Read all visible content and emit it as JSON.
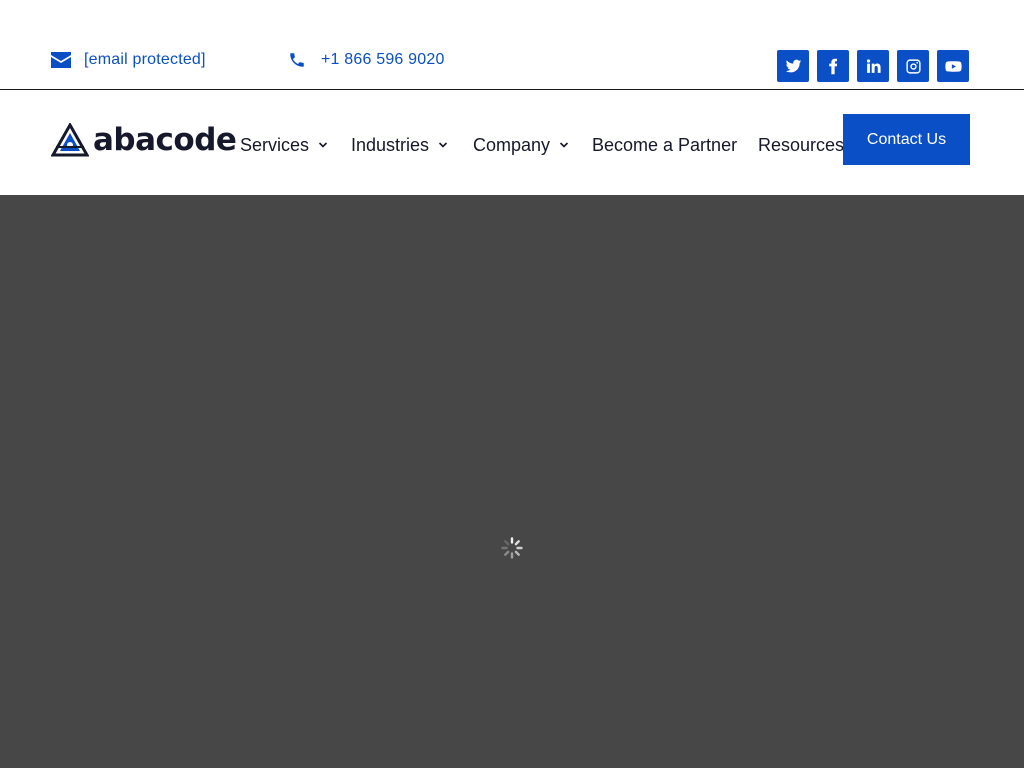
{
  "topbar": {
    "email": {
      "icon": "envelope-icon",
      "text": "[email protected]"
    },
    "phone": {
      "icon": "phone-icon",
      "text": "+1 866 596 9020"
    },
    "social": [
      "twitter-icon",
      "facebook-icon",
      "linkedin-icon",
      "instagram-icon",
      "youtube-icon"
    ]
  },
  "header": {
    "logo_text": "abacode",
    "nav": [
      {
        "label": "Services",
        "has_dropdown": true
      },
      {
        "label": "Industries",
        "has_dropdown": true
      },
      {
        "label": "Company",
        "has_dropdown": true
      },
      {
        "label": "Become a Partner",
        "has_dropdown": false
      },
      {
        "label": "Resources",
        "has_dropdown": true
      }
    ],
    "cta_label": "Contact Us"
  },
  "hero": {
    "state": "loading",
    "spinner_icon": "spinner-icon"
  },
  "colors": {
    "accent": "#0a4fc6",
    "text_dark": "#16182b",
    "hero_bg": "#474747"
  }
}
